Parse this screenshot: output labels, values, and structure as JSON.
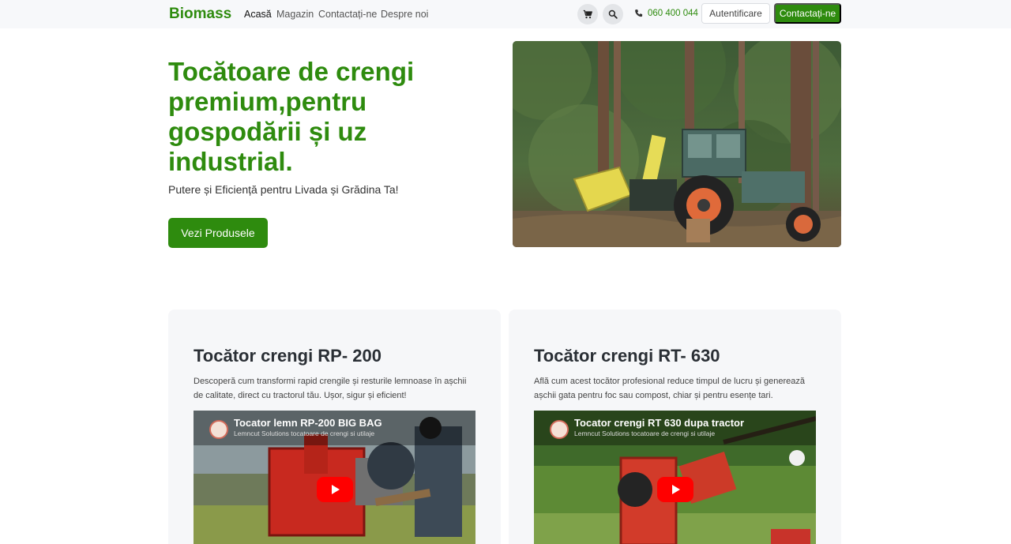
{
  "navbar": {
    "brand": "Biomass",
    "links": [
      "Acasă",
      "Magazin",
      "Contactați-ne",
      "Despre noi"
    ],
    "phone": "060 400 044",
    "login_label": "Autentificare",
    "contact_label": "Contactați-ne",
    "cart_icon": "cart-icon",
    "search_icon": "search-icon"
  },
  "hero": {
    "title": "Tocătoare de crengi premium,pentru gospodării și uz industrial.",
    "subtitle": "Putere și Eficiență pentru Livada și Grădina Ta!",
    "cta_label": "Vezi Produsele"
  },
  "cards": [
    {
      "title": "Tocător crengi RP- 200",
      "description": "Descoperă cum transformi rapid crengile și resturile lemnoase în așchii de calitate, direct cu tractorul tău. Ușor, sigur și eficient!",
      "video_title": "Tocator lemn RP-200 BIG BAG",
      "video_channel": "Lemncut Solutions tocatoare de crengi si utilaje"
    },
    {
      "title": "Tocător crengi RT- 630",
      "description": "Află cum acest tocător profesional reduce timpul de lucru și generează așchii gata pentru foc sau compost, chiar și pentru esențe tari.",
      "video_title": "Tocator crengi RT 630 dupa tractor",
      "video_channel": "Lemncut Solutions tocatoare de crengi si utilaje"
    }
  ],
  "colors": {
    "brand_green": "#2e8b0e",
    "navbar_bg": "#f7f8fa",
    "card_bg": "#f6f7f9",
    "play_red": "#ff0000"
  }
}
